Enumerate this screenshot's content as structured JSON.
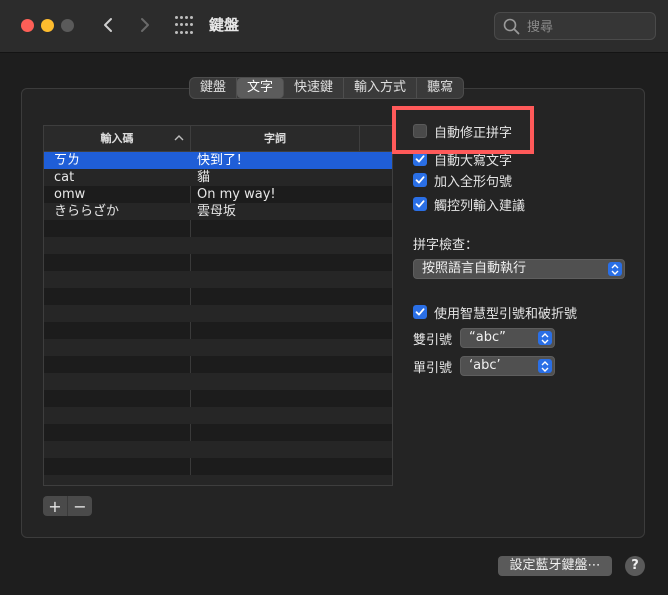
{
  "window": {
    "title": "鍵盤",
    "search_placeholder": "搜尋"
  },
  "tabs": [
    {
      "label": "鍵盤"
    },
    {
      "label": "文字",
      "active": true
    },
    {
      "label": "快速鍵"
    },
    {
      "label": "輸入方式"
    },
    {
      "label": "聽寫"
    }
  ],
  "table": {
    "columns": [
      "輸入碼",
      "字詞"
    ],
    "rows": [
      {
        "code": "ㄎㄌ",
        "word": "快到了！",
        "selected": true
      },
      {
        "code": "cat",
        "word": "貓"
      },
      {
        "code": "omw",
        "word": "On my way!"
      },
      {
        "code": "きららざか",
        "word": "雲母坂"
      }
    ],
    "add_label": "+",
    "remove_label": "−"
  },
  "options": {
    "autocorrect": {
      "label": "自動修正拼字",
      "checked": false
    },
    "auto_capitalize": {
      "label": "自動大寫文字",
      "checked": true
    },
    "fullwidth_period": {
      "label": "加入全形句號",
      "checked": true
    },
    "touchbar_suggestions": {
      "label": "觸控列輸入建議",
      "checked": true
    },
    "spelling_label": "拼字檢查：",
    "spelling_value": "按照語言自動執行",
    "smart_quotes": {
      "label": "使用智慧型引號和破折號",
      "checked": true
    },
    "double_quote_label": "雙引號",
    "double_quote_value": "“abc”",
    "single_quote_label": "單引號",
    "single_quote_value": "‘abc’"
  },
  "footer": {
    "bluetooth_button": "設定藍牙鍵盤⋯",
    "help_label": "?"
  },
  "colors": {
    "accent": "#2a6fe6",
    "highlight_box": "#ff5a5a"
  }
}
